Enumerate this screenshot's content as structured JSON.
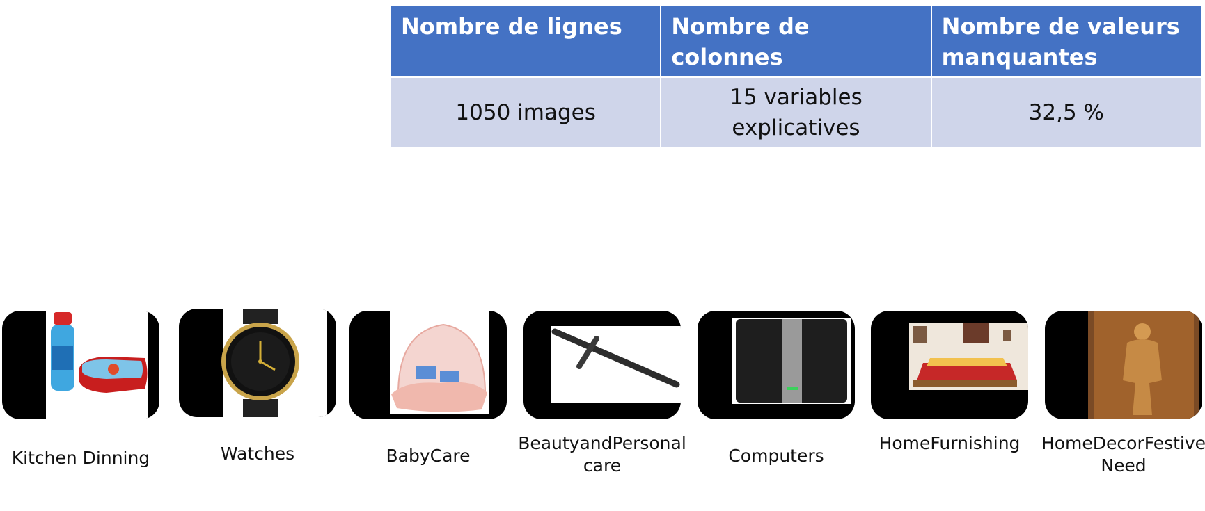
{
  "summary_table": {
    "headers": [
      "Nombre de lignes",
      "Nombre de colonnes",
      "Nombre de valeurs manquantes"
    ],
    "row": [
      "1050 images",
      "15 variables explicatives",
      "32,5 %"
    ]
  },
  "categories": [
    {
      "label": "Kitchen Dinning",
      "icon": "kitchen-dinning-product-image"
    },
    {
      "label": "Watches",
      "icon": "watch-product-image"
    },
    {
      "label": "BabyCare",
      "icon": "baby-bed-product-image"
    },
    {
      "label": "BeautyandPersonalcare",
      "icon": "eye-pencil-product-image"
    },
    {
      "label": "Computers",
      "icon": "router-product-image"
    },
    {
      "label": "HomeFurnishing",
      "icon": "bedspread-product-image"
    },
    {
      "label": "HomeDecorFestiveNeed",
      "icon": "wall-art-product-image"
    }
  ],
  "colors": {
    "header_bg": "#4472c4",
    "row_bg": "#cfd5ea",
    "thumb_bg": "#000000"
  }
}
